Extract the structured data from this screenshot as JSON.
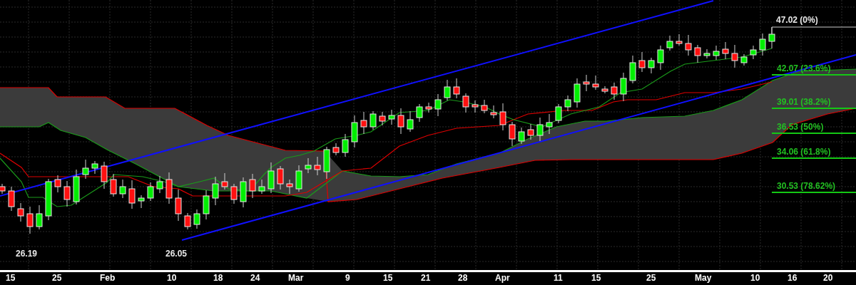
{
  "chart": {
    "last_price_label": "47.02 (0%)",
    "fibonacci_levels": [
      {
        "label": "42.07 (23.6%)"
      },
      {
        "label": "39.01 (38.2%)"
      },
      {
        "label": "36.53 (50%)"
      },
      {
        "label": "34.06 (61.8%)"
      },
      {
        "label": "30.53 (78.62%)"
      }
    ],
    "low_labels": [
      "26.19",
      "26.05"
    ],
    "x_axis_labels": [
      "15",
      "25",
      "Feb",
      "10",
      "18",
      "24",
      "Mar",
      "9",
      "15",
      "21",
      "28",
      "Apr",
      "11",
      "15",
      "25",
      "May",
      "10",
      "16",
      "20"
    ]
  }
}
